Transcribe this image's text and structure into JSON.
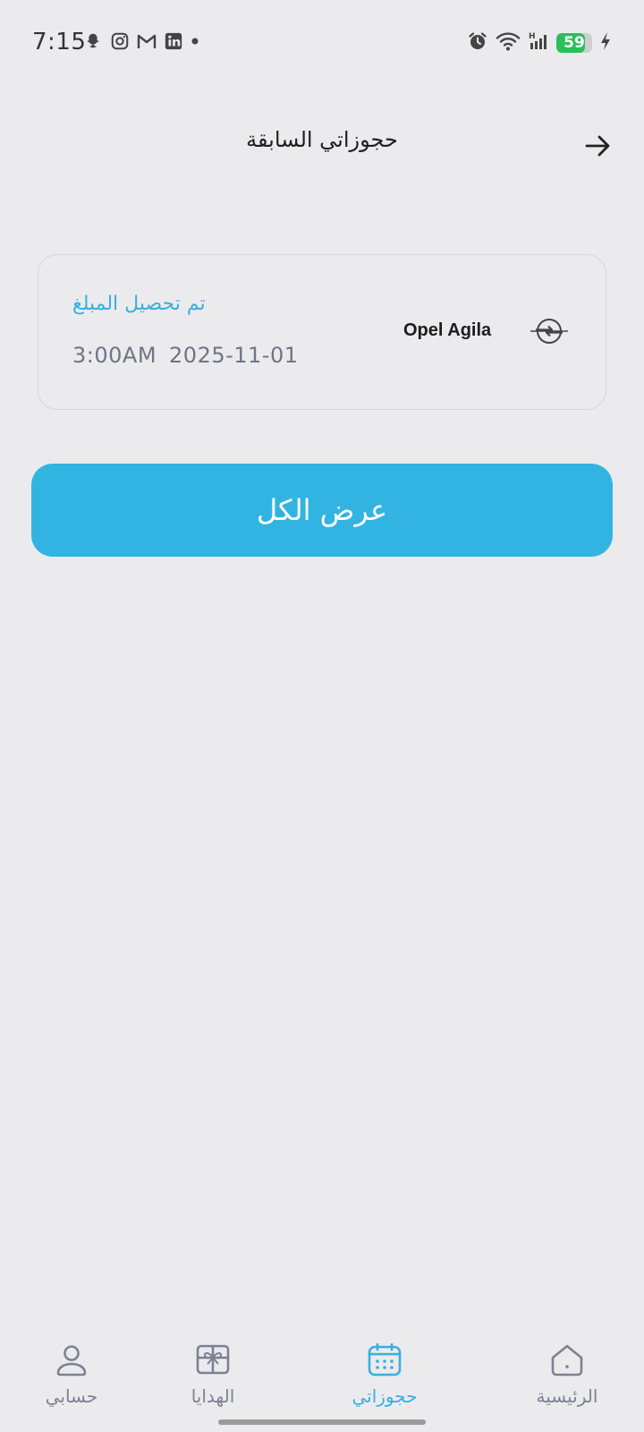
{
  "status_bar": {
    "time": "7:15",
    "battery_level": "59",
    "left_icons": [
      "snapchat-icon",
      "instagram-icon",
      "gmail-icon",
      "linkedin-icon",
      "dot-icon"
    ],
    "right_icons": [
      "alarm-icon",
      "wifi-icon",
      "signal-icon",
      "battery-icon",
      "charging-icon"
    ]
  },
  "header": {
    "title": "حجوزاتي السابقة",
    "back_icon": "arrow-right-icon"
  },
  "booking": {
    "status": "تم تحصيل المبلغ",
    "date": "2025-11-01",
    "time": "3:00AM",
    "car_name": "Opel Agila",
    "brand_icon": "opel-logo-icon"
  },
  "actions": {
    "show_all_label": "عرض الكل"
  },
  "bottom_nav": {
    "items": [
      {
        "label": "حسابي",
        "icon": "user-icon"
      },
      {
        "label": "الهدايا",
        "icon": "gift-icon"
      },
      {
        "label": "حجوزاتي",
        "icon": "calendar-icon"
      },
      {
        "label": "الرئيسية",
        "icon": "home-icon"
      }
    ],
    "active_color": "#38afe0",
    "inactive_color": "#7c8294"
  },
  "colors": {
    "accent": "#32b4e3",
    "background": "#ebebed"
  }
}
